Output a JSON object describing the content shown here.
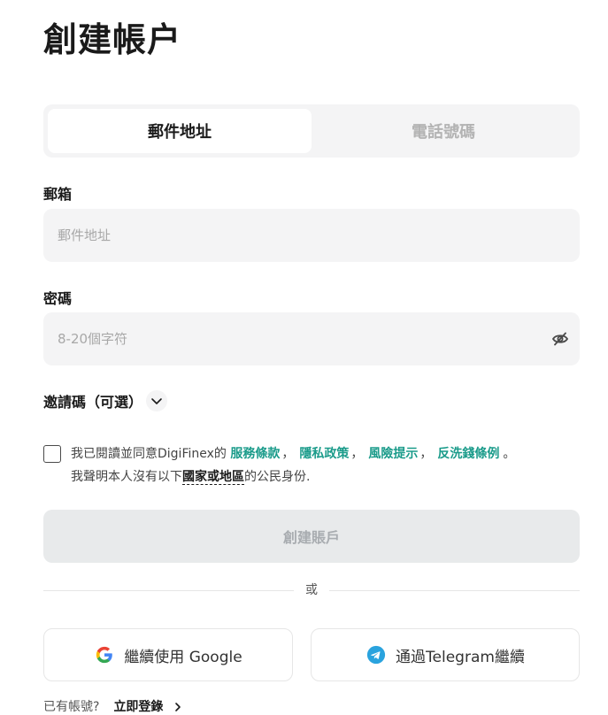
{
  "page": {
    "title": "創建帳户"
  },
  "tabs": [
    {
      "label": "郵件地址",
      "active": true
    },
    {
      "label": "電話號碼",
      "active": false
    }
  ],
  "email": {
    "label": "郵箱",
    "placeholder": "郵件地址",
    "value": ""
  },
  "password": {
    "label": "密碼",
    "placeholder": "8-20個字符",
    "value": "",
    "visibility_icon": "eye-off-icon"
  },
  "invite": {
    "label": "邀請碼（可選）",
    "icon": "chevron-down-icon"
  },
  "agreement": {
    "checked": false,
    "prefix": "我已閱讀並同意DigiFinex的",
    "links": [
      "服務條款",
      "隱私政策",
      "風險提示",
      "反洗錢條例"
    ],
    "separator": "，",
    "suffix": "。",
    "line2_prefix": "我聲明本人沒有以下",
    "line2_region": "國家或地區",
    "line2_suffix": "的公民身份."
  },
  "create_button": {
    "label": "創建賬戶",
    "disabled": true
  },
  "divider": {
    "text": "或"
  },
  "social": {
    "google": {
      "label": "繼續使用 Google",
      "icon": "google-icon"
    },
    "telegram": {
      "label": "通過Telegram繼續",
      "icon": "telegram-icon"
    }
  },
  "login": {
    "question": "已有帳號?",
    "link": "立即登錄"
  },
  "colors": {
    "accent_link": "#1a9b8a",
    "field_bg": "#f4f4f5",
    "button_disabled_bg": "#e8eaeb",
    "telegram": "#2aa3de"
  }
}
